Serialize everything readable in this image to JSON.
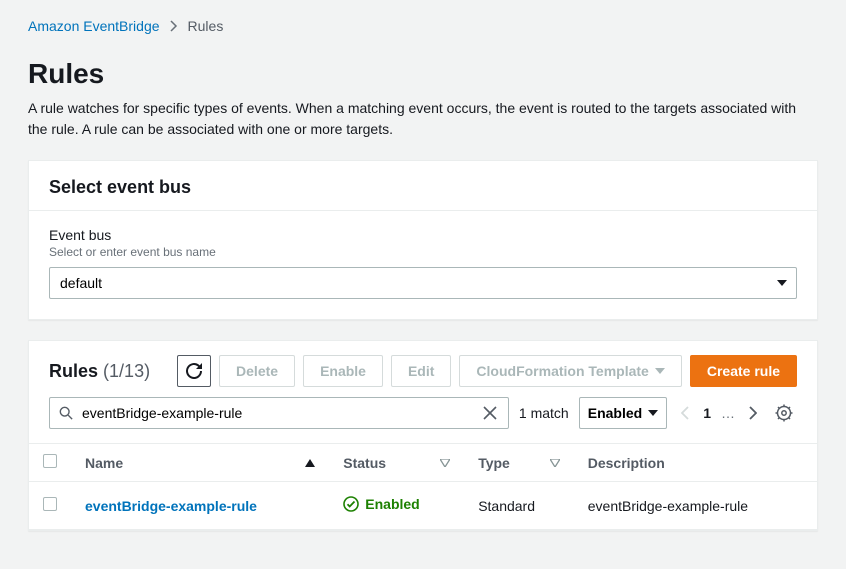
{
  "breadcrumb": {
    "root": "Amazon EventBridge",
    "current": "Rules"
  },
  "page": {
    "title": "Rules",
    "description": "A rule watches for specific types of events. When a matching event occurs, the event is routed to the targets associated with the rule. A rule can be associated with one or more targets."
  },
  "eventBusPanel": {
    "title": "Select event bus",
    "fieldLabel": "Event bus",
    "fieldHint": "Select or enter event bus name",
    "value": "default"
  },
  "rulesPanel": {
    "title": "Rules",
    "count": "(1/13)",
    "actions": {
      "refresh": "Refresh",
      "delete": "Delete",
      "enable": "Enable",
      "edit": "Edit",
      "cfTemplate": "CloudFormation Template",
      "create": "Create rule"
    },
    "filter": {
      "searchValue": "eventBridge-example-rule",
      "matchText": "1 match",
      "statusFilter": "Enabled",
      "pageNumber": "1",
      "dots": "…"
    },
    "columns": {
      "name": "Name",
      "status": "Status",
      "type": "Type",
      "description": "Description"
    },
    "rows": [
      {
        "name": "eventBridge-example-rule",
        "status": "Enabled",
        "type": "Standard",
        "description": "eventBridge-example-rule"
      }
    ]
  }
}
